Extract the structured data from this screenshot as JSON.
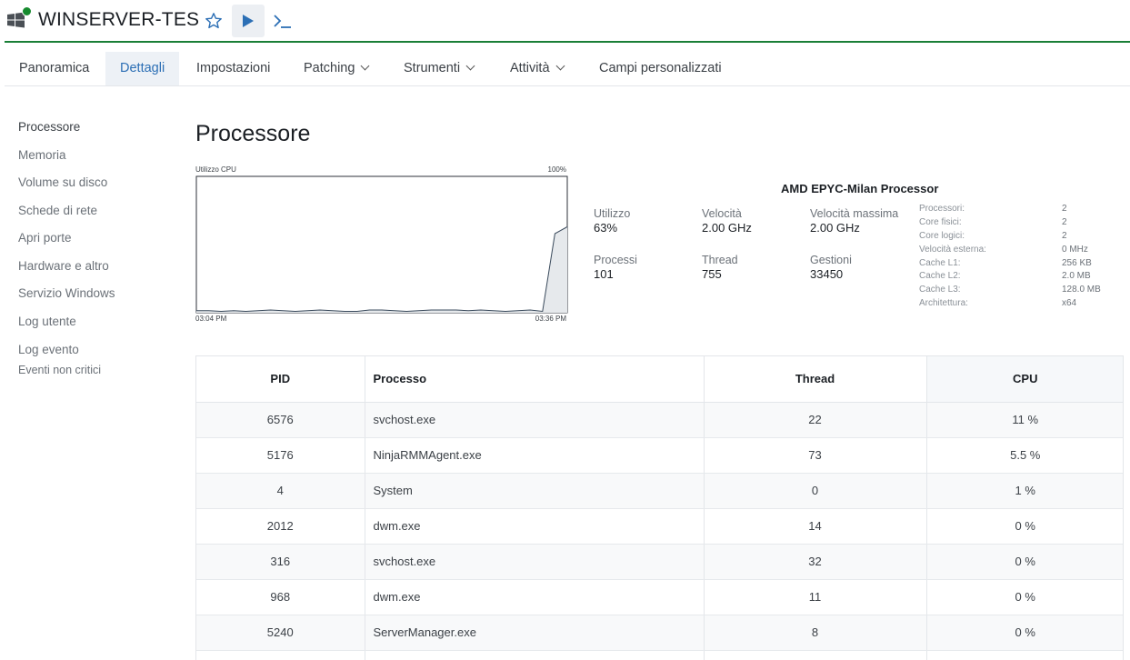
{
  "header": {
    "device_name": "WINSERVER-TES",
    "status_color": "#168a2e",
    "accent_color": "#1a7f37",
    "icons": [
      "windows-icon",
      "star-icon",
      "play-icon",
      "terminal-icon"
    ]
  },
  "tabs": [
    {
      "label": "Panoramica",
      "active": false
    },
    {
      "label": "Dettagli",
      "active": true
    },
    {
      "label": "Impostazioni",
      "active": false
    },
    {
      "label": "Patching",
      "active": false,
      "dropdown": true
    },
    {
      "label": "Strumenti",
      "active": false,
      "dropdown": true
    },
    {
      "label": "Attività",
      "active": false,
      "dropdown": true
    },
    {
      "label": "Campi personalizzati",
      "active": false
    }
  ],
  "sidenav": {
    "items": [
      {
        "label": "Processore",
        "active": true
      },
      {
        "label": "Memoria"
      },
      {
        "label": "Volume su disco"
      },
      {
        "label": "Schede di rete"
      },
      {
        "label": "Apri porte"
      },
      {
        "label": "Hardware e altro"
      },
      {
        "label": "Servizio Windows"
      },
      {
        "label": "Log utente"
      },
      {
        "label": "Log evento"
      }
    ],
    "sub_label": "Eventi non critici"
  },
  "page": {
    "title": "Processore"
  },
  "cpu_chart": {
    "title": "Utilizzo CPU",
    "max_label": "100%",
    "start_time": "03:04 PM",
    "end_time": "03:36 PM",
    "values": [
      1.5,
      1.5,
      1,
      1.5,
      1,
      1.5,
      2,
      1.5,
      1,
      1.5,
      2,
      1.5,
      1,
      1,
      2,
      2,
      1.5,
      1,
      1.5,
      2,
      2,
      2,
      1.5,
      2,
      1.5,
      1,
      1.5,
      2,
      1,
      58,
      63
    ],
    "ylim": [
      0,
      100
    ]
  },
  "processor": {
    "name": "AMD EPYC-Milan Processor",
    "stats": [
      {
        "label": "Utilizzo",
        "value": "63%"
      },
      {
        "label": "Velocità",
        "value": "2.00 GHz"
      },
      {
        "label": "Velocità massima",
        "value": "2.00 GHz"
      },
      {
        "label": "Processi",
        "value": "101"
      },
      {
        "label": "Thread",
        "value": "755"
      },
      {
        "label": "Gestioni",
        "value": "33450"
      }
    ],
    "specs": [
      {
        "label": "Processori:",
        "value": "2"
      },
      {
        "label": "Core fisici:",
        "value": "2"
      },
      {
        "label": "Core logici:",
        "value": "2"
      },
      {
        "label": "Velocità esterna:",
        "value": "0 MHz"
      },
      {
        "label": "Cache L1:",
        "value": "256 KB"
      },
      {
        "label": "Cache L2:",
        "value": "2.0 MB"
      },
      {
        "label": "Cache L3:",
        "value": "128.0 MB"
      },
      {
        "label": "Architettura:",
        "value": "x64"
      }
    ]
  },
  "process_table": {
    "headers": {
      "pid": "PID",
      "process": "Processo",
      "thread": "Thread",
      "cpu": "CPU"
    },
    "rows": [
      {
        "pid": "6576",
        "process": "svchost.exe",
        "thread": "22",
        "cpu": "11 %"
      },
      {
        "pid": "5176",
        "process": "NinjaRMMAgent.exe",
        "thread": "73",
        "cpu": "5.5 %"
      },
      {
        "pid": "4",
        "process": "System",
        "thread": "0",
        "cpu": "1 %"
      },
      {
        "pid": "2012",
        "process": "dwm.exe",
        "thread": "14",
        "cpu": "0 %"
      },
      {
        "pid": "316",
        "process": "svchost.exe",
        "thread": "32",
        "cpu": "0 %"
      },
      {
        "pid": "968",
        "process": "dwm.exe",
        "thread": "11",
        "cpu": "0 %"
      },
      {
        "pid": "5240",
        "process": "ServerManager.exe",
        "thread": "8",
        "cpu": "0 %"
      }
    ]
  }
}
